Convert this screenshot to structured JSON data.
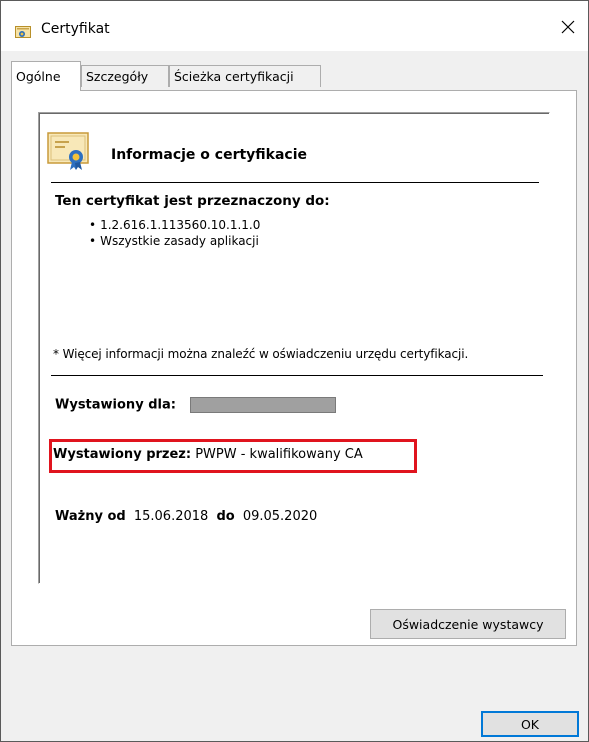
{
  "window": {
    "title": "Certyfikat",
    "close_label": "✕"
  },
  "tabs": [
    {
      "label": "Ogólne",
      "active": true
    },
    {
      "label": "Szczegóły",
      "active": false
    },
    {
      "label": "Ścieżka certyfikacji",
      "active": false
    }
  ],
  "general": {
    "heading": "Informacje o certyfikacie",
    "purpose_heading": "Ten certyfikat jest przeznaczony do:",
    "purposes": [
      "1.2.616.1.113560.10.1.1.0",
      "Wszystkie zasady aplikacji"
    ],
    "more_info": "* Więcej informacji można znaleźć w oświadczeniu urzędu certyfikacji.",
    "issued_to_label": "Wystawiony dla:",
    "issued_by_label": "Wystawiony przez:",
    "issued_by_value": "PWPW - kwalifikowany CA",
    "valid_from_label": "Ważny od",
    "valid_from": "15.06.2018",
    "valid_to_label": "do",
    "valid_to": "09.05.2020"
  },
  "buttons": {
    "issuer_statement": "Oświadczenie wystawcy",
    "ok": "OK"
  },
  "colors": {
    "highlight": "#e0141e",
    "accent": "#0078d7"
  }
}
